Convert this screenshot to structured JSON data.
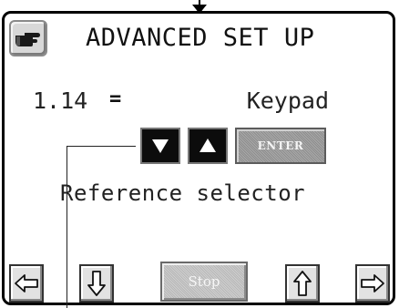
{
  "header": {
    "title": "ADVANCED SET UP",
    "hand_icon": "pointing-hand-icon"
  },
  "parameter": {
    "number": "1.14",
    "equals": "=",
    "value": "Keypad",
    "description": "Reference selector"
  },
  "controls": {
    "down_icon": "triangle-down-icon",
    "up_icon": "triangle-up-icon",
    "enter_label": "ENTER"
  },
  "nav": {
    "left_icon": "arrow-left-icon",
    "down_icon": "arrow-down-icon",
    "stop_label": "Stop",
    "up_icon": "arrow-up-icon",
    "right_icon": "arrow-right-icon"
  },
  "colors": {
    "screen_border": "#000000",
    "button_dark": "#0c0c0c",
    "button_gray": "#a0a0a0",
    "text": "#222222"
  }
}
